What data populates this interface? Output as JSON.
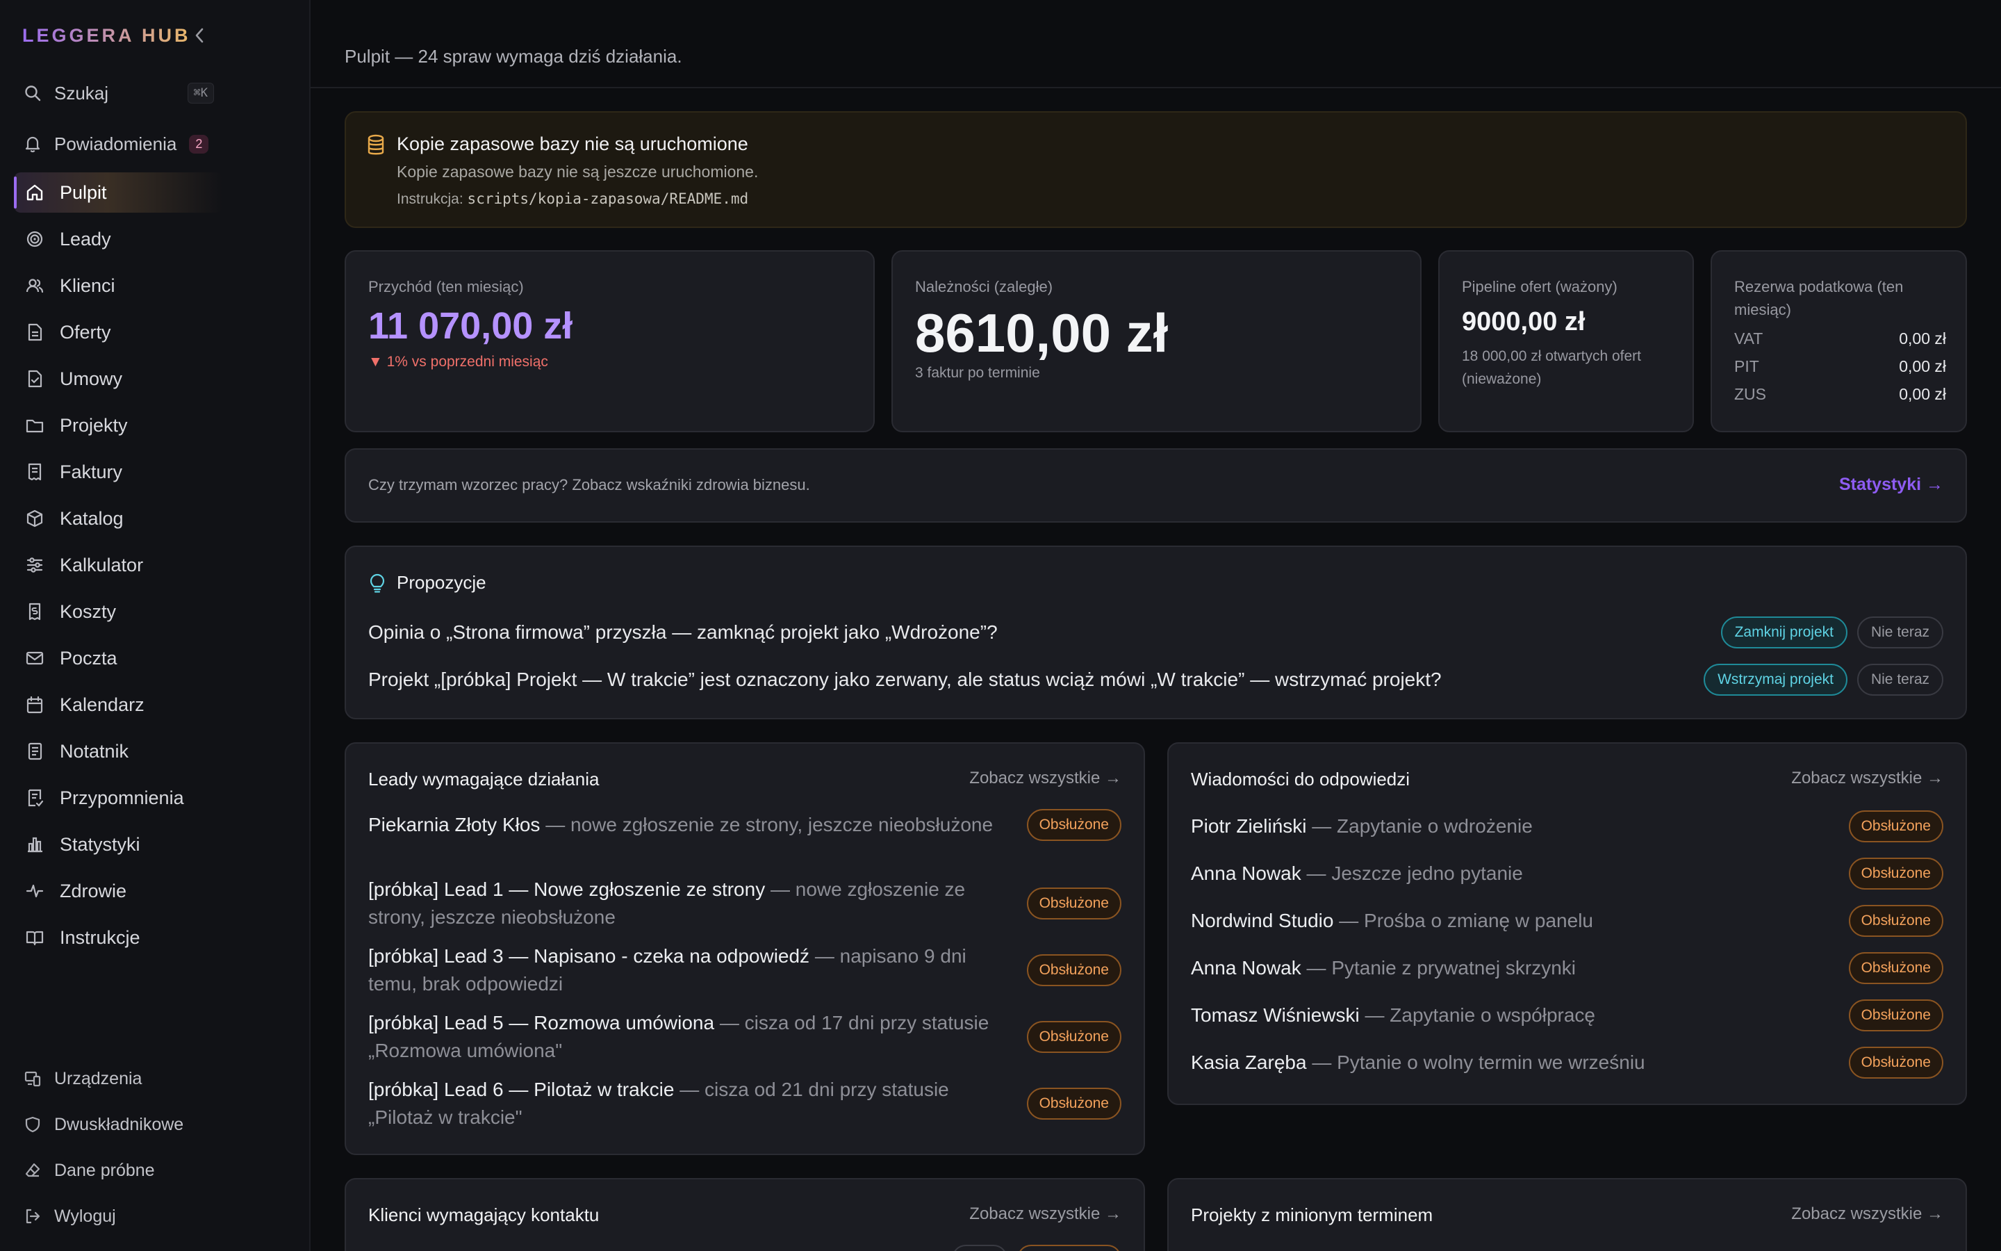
{
  "sidebar": {
    "brand": "LEGGERA HUB",
    "search_label": "Szukaj",
    "search_shortcut": "⌘K",
    "notifications_label": "Powiadomienia",
    "notifications_count": "2",
    "nav": [
      {
        "label": "Pulpit",
        "icon": "home-icon",
        "active": true
      },
      {
        "label": "Leady",
        "icon": "target-icon"
      },
      {
        "label": "Klienci",
        "icon": "users-icon"
      },
      {
        "label": "Oferty",
        "icon": "file-icon"
      },
      {
        "label": "Umowy",
        "icon": "file-check-icon"
      },
      {
        "label": "Projekty",
        "icon": "folder-icon"
      },
      {
        "label": "Faktury",
        "icon": "receipt-icon"
      },
      {
        "label": "Katalog",
        "icon": "box-icon"
      },
      {
        "label": "Kalkulator",
        "icon": "sliders-icon"
      },
      {
        "label": "Koszty",
        "icon": "wallet-receipt-icon"
      },
      {
        "label": "Poczta",
        "icon": "mail-icon"
      },
      {
        "label": "Kalendarz",
        "icon": "calendar-icon"
      },
      {
        "label": "Notatnik",
        "icon": "notebook-icon"
      },
      {
        "label": "Przypomnienia",
        "icon": "reminder-icon"
      },
      {
        "label": "Statystyki",
        "icon": "bar-chart-icon"
      },
      {
        "label": "Zdrowie",
        "icon": "pulse-icon"
      },
      {
        "label": "Instrukcje",
        "icon": "book-icon"
      }
    ],
    "bottom": [
      {
        "label": "Urządzenia",
        "icon": "devices-icon"
      },
      {
        "label": "Dwuskładnikowe",
        "icon": "shield-icon"
      },
      {
        "label": "Dane próbne",
        "icon": "eraser-icon"
      },
      {
        "label": "Wyloguj",
        "icon": "logout-icon"
      }
    ]
  },
  "header": {
    "title": "Pulpit — 24 spraw wymaga dziś działania."
  },
  "alert": {
    "title": "Kopie zapasowe bazy nie są uruchomione",
    "text": "Kopie zapasowe bazy nie są jeszcze uruchomione.",
    "instruction_label": "Instrukcja: ",
    "instruction_path": "scripts/kopia-zapasowa/README.md"
  },
  "kpis": {
    "revenue": {
      "label": "Przychód (ten miesiąc)",
      "value": "11 070,00 zł",
      "delta": "▼ 1% vs poprzedni miesiąc"
    },
    "receivables": {
      "label": "Należności (zaległe)",
      "value": "8610,00 zł",
      "sub": "3 faktur po terminie"
    },
    "pipeline": {
      "label": "Pipeline ofert (ważony)",
      "value": "9000,00 zł",
      "sub": "18 000,00 zł otwartych ofert (nieważone)"
    },
    "tax": {
      "label": "Rezerwa podatkowa (ten miesiąc)",
      "rows": [
        {
          "k": "VAT",
          "v": "0,00 zł"
        },
        {
          "k": "PIT",
          "v": "0,00 zł"
        },
        {
          "k": "ZUS",
          "v": "0,00 zł"
        }
      ]
    }
  },
  "banner": {
    "text": "Czy trzymam wzorzec pracy? Zobacz wskaźniki zdrowia biznesu.",
    "link": "Statystyki →"
  },
  "proposals": {
    "title": "Propozycje",
    "items": [
      {
        "text": "Opinia o „Strona firmowa” przyszła — zamknąć projekt jako „Wdrożone”?",
        "action": "Zamknij projekt",
        "dismiss": "Nie teraz"
      },
      {
        "text": "Projekt „[próbka] Projekt — W trakcie” jest oznaczony jako zerwany, ale status wciąż mówi „W trakcie” — wstrzymać projekt?",
        "action": "Wstrzymaj projekt",
        "dismiss": "Nie teraz"
      }
    ]
  },
  "leads": {
    "title": "Leady wymagające działania",
    "see_all": "Zobacz wszystkie →",
    "items": [
      {
        "name": "Piekarnia Złoty Kłos",
        "desc": " — nowe zgłoszenie ze strony, jeszcze nieobsłużone",
        "action": "Obsłużone"
      },
      {
        "name": "[próbka] Lead 1 — Nowe zgłoszenie ze strony",
        "desc": " — nowe zgłoszenie ze strony, jeszcze nieobsłużone",
        "action": "Obsłużone"
      },
      {
        "name": "[próbka] Lead 3 — Napisano - czeka na odpowiedź",
        "desc": " — napisano 9 dni temu, brak odpowiedzi",
        "action": "Obsłużone"
      },
      {
        "name": "[próbka] Lead 5 — Rozmowa umówiona",
        "desc": " — cisza od 17 dni przy statusie „Rozmowa umówiona\"",
        "action": "Obsłużone"
      },
      {
        "name": "[próbka] Lead 6 — Pilotaż w trakcie",
        "desc": " — cisza od 21 dni przy statusie „Pilotaż w trakcie\"",
        "action": "Obsłużone"
      }
    ]
  },
  "messages": {
    "title": "Wiadomości do odpowiedzi",
    "see_all": "Zobacz wszystkie →",
    "items": [
      {
        "name": "Piotr Zieliński",
        "desc": " — Zapytanie o wdrożenie",
        "action": "Obsłużone"
      },
      {
        "name": "Anna Nowak",
        "desc": " — Jeszcze jedno pytanie",
        "action": "Obsłużone"
      },
      {
        "name": "Nordwind Studio",
        "desc": " — Prośba o zmianę w panelu",
        "action": "Obsłużone"
      },
      {
        "name": "Anna Nowak",
        "desc": " — Pytanie z prywatnej skrzynki",
        "action": "Obsłużone"
      },
      {
        "name": "Tomasz Wiśniewski",
        "desc": " — Zapytanie o współpracę",
        "action": "Obsłużone"
      },
      {
        "name": "Kasia Zaręba",
        "desc": " — Pytanie o wolny termin we wrześniu",
        "action": "Obsłużone"
      }
    ]
  },
  "clients": {
    "title": "Klienci wymagający kontaktu",
    "see_all": "Zobacz wszystkie →"
  },
  "projects_overdue": {
    "title": "Projekty z minionym terminem",
    "see_all": "Zobacz wszystkie →"
  },
  "colors": {
    "accent": "#8e5cf2",
    "brand_start": "#9b6cf0",
    "brand_end": "#e9b768",
    "revenue": "#b592ff",
    "negative": "#f0706a",
    "cyan": "#5fd3e4",
    "orange": "#f3a25c"
  }
}
